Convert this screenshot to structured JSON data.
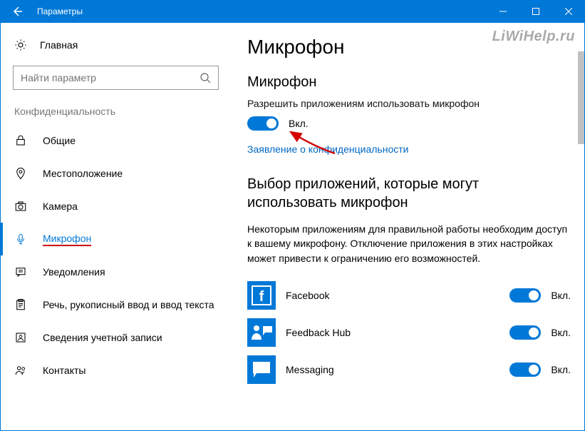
{
  "titlebar": {
    "title": "Параметры"
  },
  "sidebar": {
    "home": "Главная",
    "search_placeholder": "Найти параметр",
    "section": "Конфиденциальность",
    "items": [
      {
        "label": "Общие"
      },
      {
        "label": "Местоположение"
      },
      {
        "label": "Камера"
      },
      {
        "label": "Микрофон"
      },
      {
        "label": "Уведомления"
      },
      {
        "label": "Речь, рукописный ввод и ввод текста"
      },
      {
        "label": "Сведения учетной записи"
      },
      {
        "label": "Контакты"
      }
    ]
  },
  "watermark": "LiWiHelp.ru",
  "main": {
    "h1": "Микрофон",
    "h2": "Микрофон",
    "allow_text": "Разрешить приложениям использовать микрофон",
    "toggle_state": "Вкл.",
    "privacy_link": "Заявление о конфиденциальности",
    "choose_h2": "Выбор приложений, которые могут использовать микрофон",
    "note": "Некоторым приложениям для правильной работы необходим доступ к вашему микрофону. Отключение приложения в этих настройках может привести к ограничению его возможностей.",
    "apps": [
      {
        "name": "Facebook",
        "state": "Вкл."
      },
      {
        "name": "Feedback Hub",
        "state": "Вкл."
      },
      {
        "name": "Messaging",
        "state": "Вкл."
      }
    ]
  }
}
